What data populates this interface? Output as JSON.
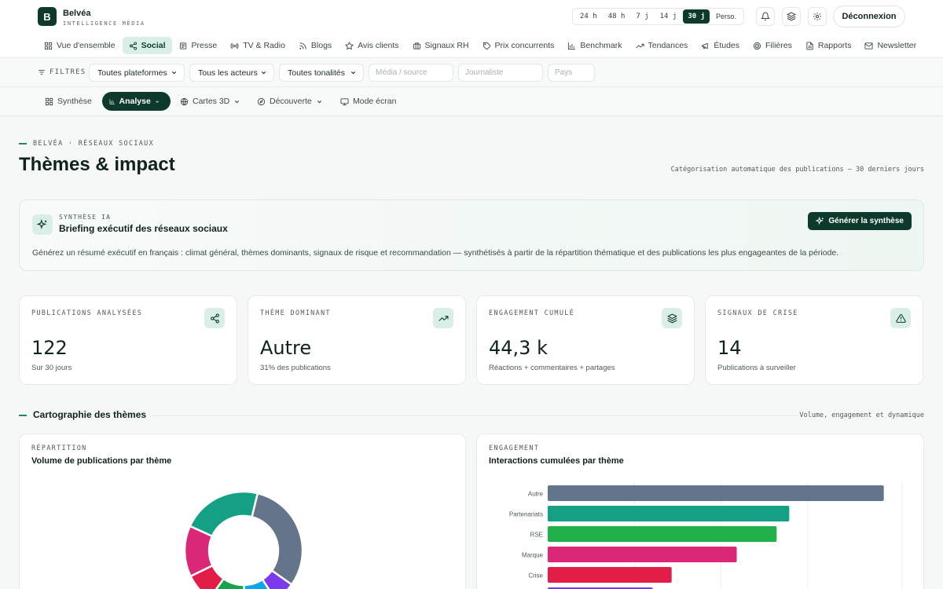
{
  "brand": {
    "logo_letter": "B",
    "name": "Belvéa",
    "tagline": "INTELLIGENCE MÉDIA"
  },
  "periods": [
    {
      "label": "24 h",
      "active": false
    },
    {
      "label": "48 h",
      "active": false
    },
    {
      "label": "7 j",
      "active": false
    },
    {
      "label": "14 j",
      "active": false
    },
    {
      "label": "30 j",
      "active": true
    },
    {
      "label": "Perso.",
      "active": false
    }
  ],
  "header_icons": [
    "bell-icon",
    "layers-icon",
    "gear-icon"
  ],
  "logout_label": "Déconnexion",
  "nav": [
    {
      "label": "Vue d'ensemble",
      "icon": "grid-icon",
      "active": false
    },
    {
      "label": "Social",
      "icon": "share-icon",
      "active": true
    },
    {
      "label": "Presse",
      "icon": "newspaper-icon",
      "active": false
    },
    {
      "label": "TV & Radio",
      "icon": "broadcast-icon",
      "active": false
    },
    {
      "label": "Blogs",
      "icon": "rss-icon",
      "active": false
    },
    {
      "label": "Avis clients",
      "icon": "star-icon",
      "active": false
    },
    {
      "label": "Signaux RH",
      "icon": "briefcase-icon",
      "active": false
    },
    {
      "label": "Prix concurrents",
      "icon": "tag-icon",
      "active": false
    },
    {
      "label": "Benchmark",
      "icon": "bar-chart-icon",
      "active": false
    },
    {
      "label": "Tendances",
      "icon": "trending-icon",
      "active": false
    },
    {
      "label": "Études",
      "icon": "megaphone-icon",
      "active": false
    },
    {
      "label": "Filières",
      "icon": "target-icon",
      "active": false
    },
    {
      "label": "Rapports",
      "icon": "file-icon",
      "active": false
    },
    {
      "label": "Newsletter",
      "icon": "mail-icon",
      "active": false
    }
  ],
  "filters": {
    "label": "FILTRES",
    "platform": "Toutes plateformes",
    "actors": "Tous les acteurs",
    "tone": "Toutes tonalités",
    "media_placeholder": "Média / source",
    "journalist_placeholder": "Journaliste",
    "country_placeholder": "Pays"
  },
  "subnav": [
    {
      "label": "Synthèse",
      "icon": "grid-icon",
      "active": false,
      "dropdown": false
    },
    {
      "label": "Analyse",
      "icon": "bar-chart-icon",
      "active": true,
      "dropdown": true
    },
    {
      "label": "Cartes 3D",
      "icon": "globe-icon",
      "active": false,
      "dropdown": true
    },
    {
      "label": "Découverte",
      "icon": "compass-icon",
      "active": false,
      "dropdown": true
    },
    {
      "label": "Mode écran",
      "icon": "monitor-icon",
      "active": false,
      "dropdown": false
    }
  ],
  "page": {
    "eyebrow": "BELVÉA · RÉSEAUX SOCIAUX",
    "title": "Thèmes & impact",
    "caption": "Catégorisation automatique des publications — 30 derniers jours"
  },
  "ai": {
    "eyebrow": "SYNTHÈSE IA",
    "title": "Briefing exécutif des réseaux sociaux",
    "description": "Générez un résumé exécutif en français : climat général, thèmes dominants, signaux de risque et recommandation — synthétisés à partir de la répartition thématique et des publications les plus engageantes de la période.",
    "button": "Générer la synthèse"
  },
  "kpis": [
    {
      "label": "PUBLICATIONS ANALYSÉES",
      "value": "122",
      "sub": "Sur 30 jours",
      "icon": "share-icon"
    },
    {
      "label": "THÈME DOMINANT",
      "value": "Autre",
      "sub": "31% des publications",
      "icon": "trending-icon"
    },
    {
      "label": "ENGAGEMENT CUMULÉ",
      "value": "44,3 k",
      "sub": "Réactions + commentaires + partages",
      "icon": "layers-icon"
    },
    {
      "label": "SIGNAUX DE CRISE",
      "value": "14",
      "sub": "Publications à surveiller",
      "icon": "alert-triangle-icon"
    }
  ],
  "section": {
    "title": "Cartographie des thèmes",
    "caption": "Volume, engagement et dynamique"
  },
  "colors": {
    "accent": "#0e3a2e",
    "accent_soft": "#d9efe6",
    "green_line": "#1a8a66"
  },
  "chart_data": [
    {
      "type": "pie",
      "eyebrow": "RÉPARTITION",
      "title": "Volume de publications par thème",
      "slices": [
        {
          "value": 31,
          "color": "#64748b"
        },
        {
          "value": 6,
          "color": "#7c3aed"
        },
        {
          "value": 9,
          "color": "#0ea5e9"
        },
        {
          "value": 10,
          "color": "#16a34a"
        },
        {
          "value": 8,
          "color": "#e11d48"
        },
        {
          "value": 14,
          "color": "#db2777"
        },
        {
          "value": 22,
          "color": "#14a085"
        }
      ]
    },
    {
      "type": "bar",
      "orientation": "horizontal",
      "eyebrow": "ENGAGEMENT",
      "title": "Interactions cumulées par thème",
      "categories": [
        "Autre",
        "Partenariats",
        "RSE",
        "Marque",
        "Crise",
        ""
      ],
      "values": [
        16000,
        11500,
        10900,
        9000,
        5900,
        5000
      ],
      "colors": [
        "#64748b",
        "#14a085",
        "#22b04b",
        "#db2777",
        "#e11d48",
        "#7c3aed"
      ],
      "xlim": [
        0,
        16500
      ]
    }
  ]
}
